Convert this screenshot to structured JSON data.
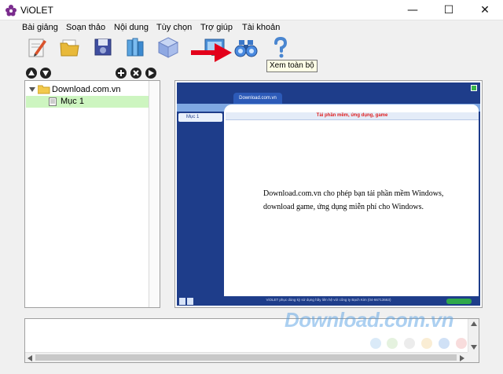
{
  "window": {
    "title": "ViOLET",
    "controls": {
      "minimize": "—",
      "maximize": "☐",
      "close": "✕"
    }
  },
  "menu": {
    "items": [
      "Bài giảng",
      "Soạn thảo",
      "Nội dung",
      "Tùy chọn",
      "Trợ giúp",
      "Tài khoản"
    ]
  },
  "toolbar": {
    "icons": [
      "edit-icon",
      "open-folder-icon",
      "save-icon",
      "books-icon",
      "cube-icon",
      "screen-icon",
      "binoculars-icon",
      "help-icon"
    ],
    "tooltip": "Xem toàn bộ"
  },
  "tree": {
    "root_label": "Download.com.vn",
    "child_label": "Mục 1"
  },
  "preview": {
    "tab_label": "Download.com.vn",
    "side_item": "Mục 1",
    "slide_title": "Tải phần mềm, ứng dụng, game",
    "body_line1": "Download.com.vn cho phép bạn tải phần mềm Windows,",
    "body_line2": "download game, ứng dụng miễn phí cho Windows.",
    "footer": "ViOLET phục dùng kỳ sử dụng hãy liên hệ với công ty Bạch Kim (04-66713663)"
  },
  "watermark": {
    "text": "Download.com.vn",
    "dot_colors": [
      "#bcd9f2",
      "#cfe8c4",
      "#dcdcdc",
      "#f6dfb0",
      "#aac8ee",
      "#f3c0c0"
    ]
  },
  "colors": {
    "menu_bar": "#f0f0f0",
    "tree_selected": "#cdf5c0",
    "slide_blue": "#1e3d8a",
    "arrow_red": "#e3001b",
    "slide_title_red": "#e02020"
  }
}
